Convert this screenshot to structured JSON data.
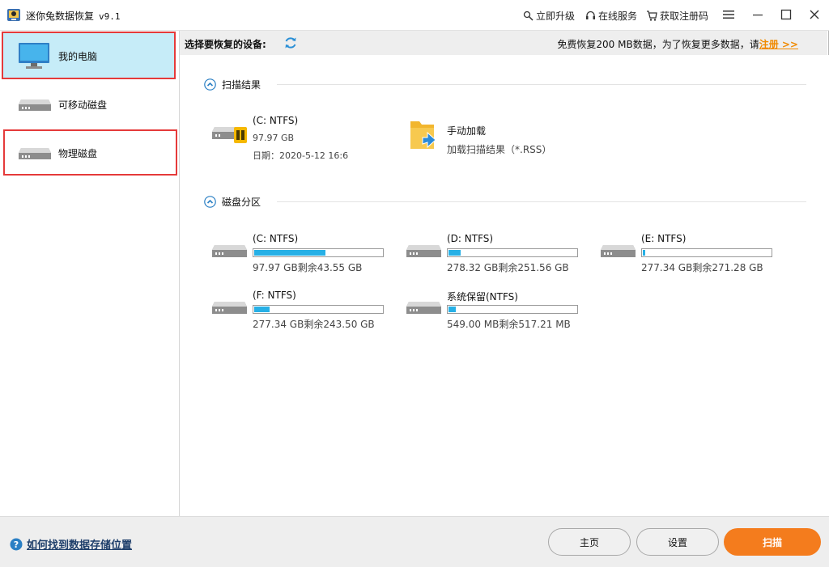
{
  "window": {
    "title": "迷你兔数据恢复",
    "version": "v9.1",
    "links": {
      "upgrade": "立即升级",
      "online_service": "在线服务",
      "get_code": "获取注册码"
    }
  },
  "sidebar": {
    "items": [
      {
        "label": "我的电脑",
        "icon": "monitor-icon",
        "selected": true
      },
      {
        "label": "可移动磁盘",
        "icon": "drive-icon",
        "selected": false
      },
      {
        "label": "物理磁盘",
        "icon": "drive-icon",
        "selected": false
      }
    ]
  },
  "device_bar": {
    "label": "选择要恢复的设备:",
    "promo_text": "免费恢复200 MB数据，为了恢复更多数据，请",
    "register_link": "注册 >>"
  },
  "scan_results": {
    "heading": "扫描结果",
    "items": [
      {
        "name": "(C: NTFS)",
        "size": "97.97 GB",
        "date": "日期：2020-5-12 16:6"
      }
    ],
    "manual": {
      "title": "手动加载",
      "subtitle": "加载扫描结果（*.RSS）"
    }
  },
  "partitions": {
    "heading": "磁盘分区",
    "items": [
      {
        "name": "(C: NTFS)",
        "size": "97.97 GB剩余43.55 GB",
        "used_fraction": 0.556
      },
      {
        "name": "(D: NTFS)",
        "size": "278.32 GB剩余251.56 GB",
        "used_fraction": 0.096
      },
      {
        "name": "(E: NTFS)",
        "size": "277.34 GB剩余271.28 GB",
        "used_fraction": 0.022
      },
      {
        "name": "(F: NTFS)",
        "size": "277.34 GB剩余243.50 GB",
        "used_fraction": 0.122
      },
      {
        "name": "系统保留(NTFS)",
        "size": "549.00 MB剩余517.21 MB",
        "used_fraction": 0.058
      }
    ]
  },
  "footer": {
    "help": "如何找到数据存储位置",
    "home": "主页",
    "settings": "设置",
    "scan": "扫描"
  },
  "colors": {
    "accent": "#f47c1d",
    "progress": "#27b0e6",
    "selected_bg": "#c6ecf8",
    "highlight": "#e53a3a"
  }
}
